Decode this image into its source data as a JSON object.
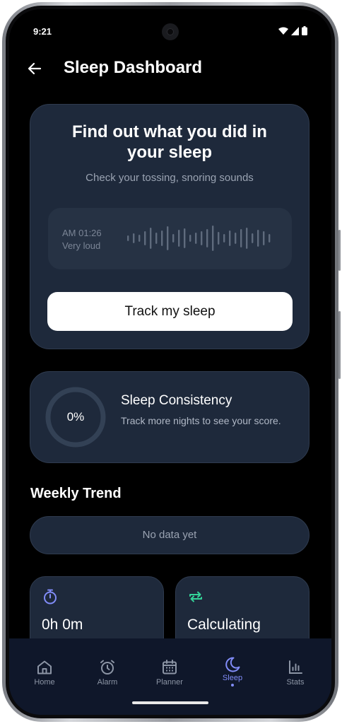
{
  "status_bar": {
    "time": "9:21"
  },
  "header": {
    "title": "Sleep Dashboard"
  },
  "hero": {
    "title": "Find out what you did in your sleep",
    "subtitle": "Check your tossing, snoring sounds",
    "sample": {
      "time": "AM 01:26",
      "level": "Very loud"
    },
    "button_label": "Track my sleep"
  },
  "consistency": {
    "percent_label": "0%",
    "progress": 0,
    "title": "Sleep Consistency",
    "description": "Track more nights to see your score."
  },
  "weekly_trend": {
    "title": "Weekly Trend",
    "empty_text": "No data yet"
  },
  "stats": [
    {
      "icon": "stopwatch-icon",
      "value": "0h 0m",
      "color": "#818cf8"
    },
    {
      "icon": "repeat-icon",
      "value": "Calculating",
      "color": "#34d399"
    }
  ],
  "nav": {
    "items": [
      {
        "label": "Home",
        "icon": "home-icon",
        "active": false
      },
      {
        "label": "Alarm",
        "icon": "alarm-clock-icon",
        "active": false
      },
      {
        "label": "Planner",
        "icon": "calendar-icon",
        "active": false
      },
      {
        "label": "Sleep",
        "icon": "moon-icon",
        "active": true
      },
      {
        "label": "Stats",
        "icon": "bar-chart-icon",
        "active": false
      }
    ]
  },
  "colors": {
    "background": "#000000",
    "card": "#1e293b",
    "accent": "#818cf8",
    "accent_green": "#34d399"
  }
}
